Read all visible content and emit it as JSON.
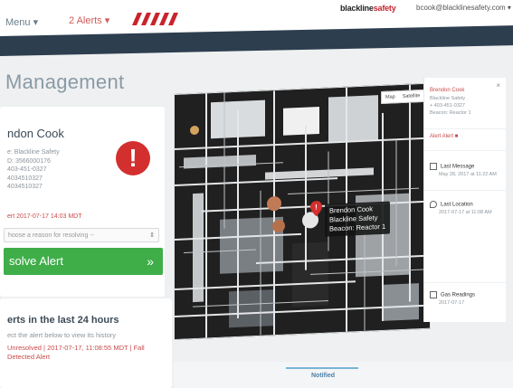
{
  "topbar": {
    "menu_label": "Menu ▾",
    "alerts_label": "2 Alerts ▾",
    "brand_main": "blackline",
    "brand_accent": "safety",
    "user_email": "bcook@blacklinesafety.com ▾",
    "colors": {
      "navy": "#2d3e4f",
      "alert_red": "#d45a5a",
      "brand_red": "#c8242b"
    }
  },
  "page": {
    "title": "Management"
  },
  "alert_card": {
    "name": "ndon Cook",
    "info_lines": [
      "e: Blackline Safety",
      "D: 3566000176",
      "403-451-0327",
      "4034510327",
      "4034510327"
    ],
    "alert_time": "ert 2017-07-17 14:03 MDT",
    "badge_icon": "exclamation-icon",
    "reason_placeholder": "hoose a reason for resolving --",
    "resolve_label": "solve Alert",
    "resolve_chevron": "»",
    "colors": {
      "badge": "#d32f2f",
      "resolve": "#3fae49"
    }
  },
  "history": {
    "heading": "erts in the last 24 hours",
    "subtext": "ect the alert below to view its history",
    "item_status": "Unresolved",
    "item_timestamp": "2017-07-17, 11:08:55 MDT",
    "item_type_a": "Fall",
    "item_type_b": "Detected Alert"
  },
  "map": {
    "control_map": "Map",
    "control_satellite": "Satellite",
    "callout_lines": [
      "Brendon Cook",
      "Blackline Safety",
      "Beacon: Reactor 1"
    ],
    "pin_icon": "map-pin-icon"
  },
  "side_panel": {
    "close_icon": "×",
    "name_lines": [
      "Brendon Cook",
      "Blackline Safety"
    ],
    "phone": "+ 403-451-0327",
    "beacon": "Beacon: Reactor 1",
    "alert_link": "Alert Alert ■",
    "rows": [
      {
        "icon": "message-icon",
        "label": "Last Message",
        "detail": "May 28, 2017 at 11:22 AM"
      },
      {
        "icon": "location-icon",
        "label": "Last Location",
        "detail": "2017-07-17 at 11:08 AM"
      },
      {
        "icon": "gas-icon",
        "label": "Gas Readings",
        "detail": "2017-07-17"
      }
    ]
  },
  "bottom": {
    "notified_label": "Notified"
  }
}
